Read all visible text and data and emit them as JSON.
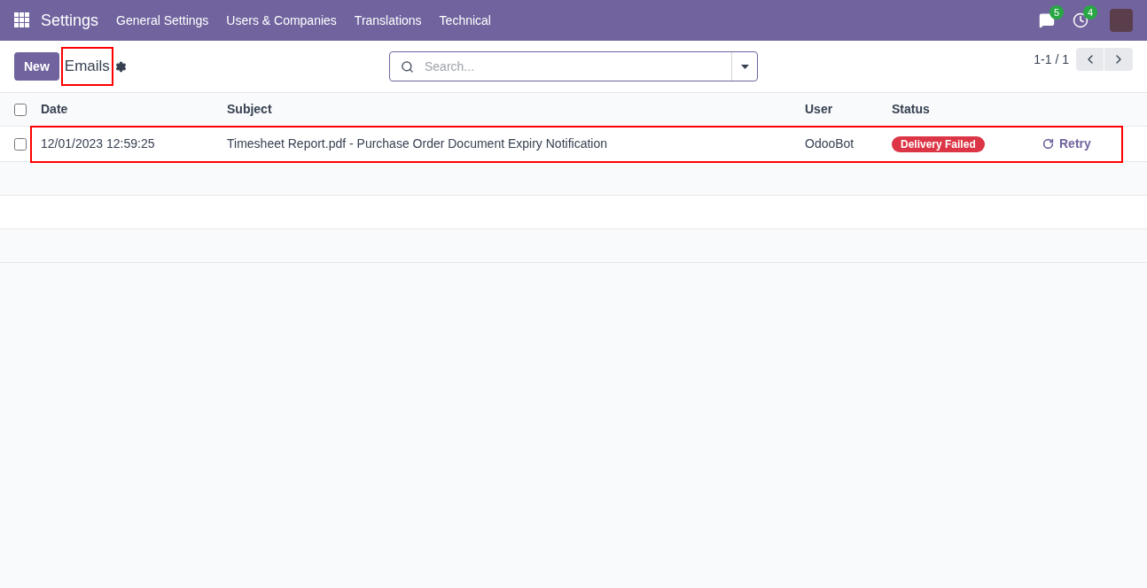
{
  "navbar": {
    "app": "Settings",
    "menu": [
      "General Settings",
      "Users & Companies",
      "Translations",
      "Technical"
    ],
    "messages_count": "5",
    "activities_count": "4"
  },
  "control_panel": {
    "new_button": "New",
    "title": "Emails",
    "title_highlighted": true,
    "search": {
      "placeholder": "Search..."
    },
    "pager": "1-1 / 1"
  },
  "table": {
    "columns": [
      "Date",
      "Subject",
      "User",
      "Status"
    ],
    "select_all_checked": false,
    "rows": [
      {
        "checked": false,
        "highlighted": true,
        "date": "12/01/2023 12:59:25",
        "subject": "Timesheet Report.pdf - Purchase Order Document Expiry Notification",
        "user": "OdooBot",
        "status": "Delivery Failed",
        "color": "#dc3545",
        "action": "Retry"
      }
    ]
  }
}
